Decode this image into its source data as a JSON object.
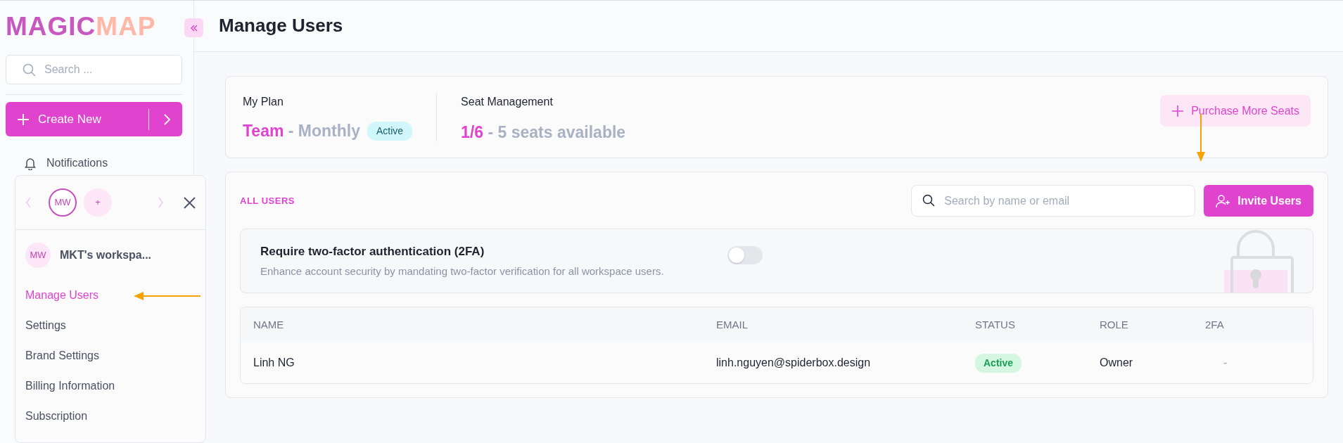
{
  "sidebar": {
    "logo": {
      "first": "MAGIC",
      "second": "MAP"
    },
    "search": {
      "placeholder": "Search ..."
    },
    "create_button": "Create New",
    "items": [
      {
        "label": "Notifications"
      }
    ]
  },
  "workspace_popup": {
    "avatars": [
      {
        "initials": "MW",
        "selected": true
      },
      {
        "initials": "+",
        "selected": false
      }
    ],
    "workspace": {
      "initials": "MW",
      "name": "MKT's workspa..."
    },
    "menu": [
      {
        "label": "Manage Users",
        "selected": true
      },
      {
        "label": "Settings",
        "selected": false
      },
      {
        "label": "Brand Settings",
        "selected": false
      },
      {
        "label": "Billing Information",
        "selected": false
      },
      {
        "label": "Subscription",
        "selected": false
      }
    ]
  },
  "header": {
    "title": "Manage Users"
  },
  "plan": {
    "label": "My Plan",
    "name": "Team",
    "period": "- Monthly",
    "status": "Active",
    "seats_label": "Seat Management",
    "seats_used": "1/6",
    "seats_text": "- 5 seats available",
    "purchase_button": "Purchase More Seats"
  },
  "users": {
    "heading": "ALL USERS",
    "search": {
      "placeholder": "Search by name or email"
    },
    "invite_button": "Invite Users",
    "two_factor": {
      "title": "Require two-factor authentication (2FA)",
      "description": "Enhance account security by mandating two-factor verification for all workspace users.",
      "on": false
    },
    "table": {
      "columns": [
        "NAME",
        "EMAIL",
        "STATUS",
        "ROLE",
        "2FA"
      ],
      "rows": [
        {
          "name": "Linh NG",
          "email": "linh.nguyen@spiderbox.design",
          "status": "Active",
          "role": "Owner",
          "two_factor": "-"
        }
      ]
    }
  }
}
